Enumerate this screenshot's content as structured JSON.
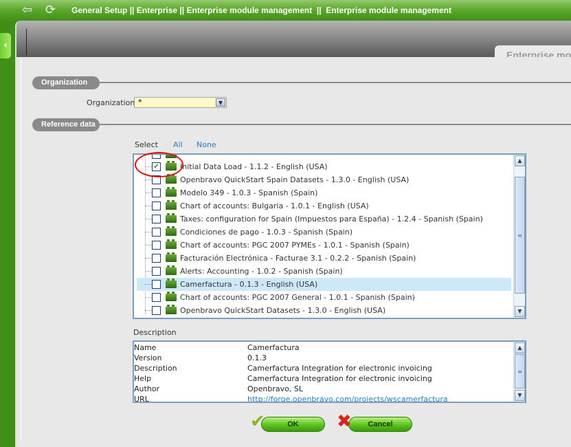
{
  "header": {
    "breadcrumb": "General Setup || Enterprise || Enterprise module management  ||  Enterprise module management",
    "back_icon": "back-arrow-icon",
    "refresh_icon": "refresh-icon"
  },
  "tab": {
    "label": "Enterprise module management"
  },
  "sections": {
    "organization": "Organization",
    "reference_data": "Reference data"
  },
  "organization": {
    "label": "Organization",
    "value": "*"
  },
  "select_bar": {
    "label": "Select",
    "all": "All",
    "none": "None"
  },
  "modules": [
    {
      "label": "Initial Data Load - 1.1.2 - English (USA)",
      "checked": true,
      "selected": false
    },
    {
      "label": "Openbravo QuickStart Spain Datasets - 1.3.0 - English (USA)",
      "checked": false,
      "selected": false
    },
    {
      "label": "Modelo 349 - 1.0.3 - Spanish (Spain)",
      "checked": false,
      "selected": false
    },
    {
      "label": "Chart of accounts: Bulgaria - 1.0.1 - English (USA)",
      "checked": false,
      "selected": false
    },
    {
      "label": "Taxes: configuration for Spain (Impuestos para España) - 1.2.4 - Spanish (Spain)",
      "checked": false,
      "selected": false
    },
    {
      "label": "Condiciones de pago - 1.0.3 - Spanish (Spain)",
      "checked": false,
      "selected": false
    },
    {
      "label": "Chart of accounts: PGC 2007 PYMEs - 1.0.1 - Spanish (Spain)",
      "checked": false,
      "selected": false
    },
    {
      "label": "Facturación Electrónica - Facturae 3.1 - 0.2.2 - Spanish (Spain)",
      "checked": false,
      "selected": false
    },
    {
      "label": "Alerts: Accounting - 1.0.2 - Spanish (Spain)",
      "checked": false,
      "selected": false
    },
    {
      "label": "Camerfactura - 0.1.3 - English (USA)",
      "checked": false,
      "selected": true
    },
    {
      "label": "Chart of accounts: PGC 2007 General - 1.0.1 - Spanish (Spain)",
      "checked": false,
      "selected": false
    },
    {
      "label": "Openbravo QuickStart Datasets - 1.3.0 - English (USA)",
      "checked": false,
      "selected": false
    }
  ],
  "description": {
    "label": "Description",
    "rows": [
      {
        "key": "Name",
        "value": "Camerfactura"
      },
      {
        "key": "Version",
        "value": "0.1.3"
      },
      {
        "key": "Description",
        "value": "Camerfactura Integration for electronic invoicing"
      },
      {
        "key": "Help",
        "value": "Camerfactura Integration for electronic invoicing"
      },
      {
        "key": "Author",
        "value": "Openbravo, SL"
      },
      {
        "key": "URL",
        "value": "http://forge.openbravo.com/projects/wscamerfactura"
      }
    ]
  },
  "buttons": {
    "ok": "OK",
    "cancel": "Cancel"
  },
  "colors": {
    "topbar": "#4a9a1e",
    "selected_row": "#cde8f8",
    "highlight_circle": "#e01010"
  }
}
